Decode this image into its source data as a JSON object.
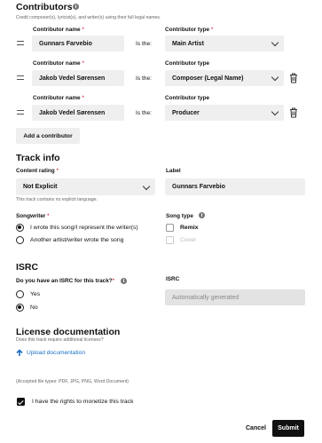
{
  "contributors": {
    "title": "Contributors",
    "subtitle": "Credit composer(s), lyricist(s), and writer(s) using their full legal names.",
    "name_label": "Contributor name",
    "type_label": "Contributor type",
    "is_the": "Is the:",
    "rows": [
      {
        "name": "Gunnars Farvebio",
        "type": "Main Artist"
      },
      {
        "name": "Jakob Vedel Sørensen",
        "type": "Composer (Legal Name)"
      },
      {
        "name": "Jakob Vedel Sørensen",
        "type": "Producer"
      }
    ],
    "add_button": "Add a contributor"
  },
  "track_info": {
    "title": "Track info",
    "content_rating_label": "Content rating",
    "content_rating_value": "Not Explicit",
    "content_rating_note": "This track contains no explicit language.",
    "label_label": "Label",
    "label_value": "Gunnars Farvebio",
    "songwriter_label": "Songwriter",
    "songwriter_options": [
      "I wrote this song/I represent the writer(s)",
      "Another artist/writer wrote the song"
    ],
    "songwriter_selected": 0,
    "song_type_label": "Song type",
    "song_type_options": [
      "Remix",
      "Cover"
    ]
  },
  "isrc": {
    "title": "ISRC",
    "question": "Do you have an ISRC for this track?",
    "options": [
      "Yes",
      "No"
    ],
    "selected": 1,
    "field_label": "ISRC",
    "field_value": "Automatically generated"
  },
  "license": {
    "title": "License documentation",
    "subtitle": "Does this track require additional licenses?",
    "upload_label": "Upload documentation",
    "accepted": "(Accepted file types: PDF, JPG, PNG, Word Document)"
  },
  "rights": {
    "label": "I have the rights to monetize this track",
    "checked": true
  },
  "footer": {
    "cancel": "Cancel",
    "submit": "Submit"
  },
  "icons": {
    "info": "info-icon",
    "trash": "trash-icon",
    "drag": "drag-handle-icon",
    "upload": "upload-arrow-icon",
    "chevron": "chevron-down-icon"
  },
  "colors": {
    "accent_link": "#1a6fc4",
    "required": "#d0021b",
    "primary_button": "#111111"
  }
}
